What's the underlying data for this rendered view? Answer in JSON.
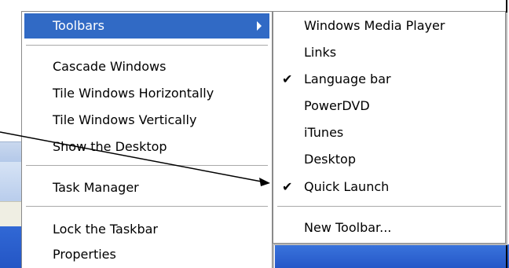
{
  "main_menu": {
    "toolbars_label": "Toolbars",
    "cascade_label": "Cascade Windows",
    "tile_h_label": "Tile Windows Horizontally",
    "tile_v_label": "Tile Windows Vertically",
    "show_desktop_label": "Show the Desktop",
    "task_manager_label": "Task Manager",
    "lock_taskbar_label": "Lock the Taskbar",
    "properties_label": "Properties"
  },
  "toolbars_submenu": {
    "items": [
      {
        "label": "Windows Media Player",
        "checked": false
      },
      {
        "label": "Links",
        "checked": false
      },
      {
        "label": "Language bar",
        "checked": true
      },
      {
        "label": "PowerDVD",
        "checked": false
      },
      {
        "label": "iTunes",
        "checked": false
      },
      {
        "label": "Desktop",
        "checked": false
      },
      {
        "label": "Quick Launch",
        "checked": true
      }
    ],
    "new_toolbar_label": "New Toolbar...",
    "check_glyph": "✔"
  },
  "colors": {
    "highlight": "#316ac5",
    "taskbar_blue": "#2557c8"
  }
}
